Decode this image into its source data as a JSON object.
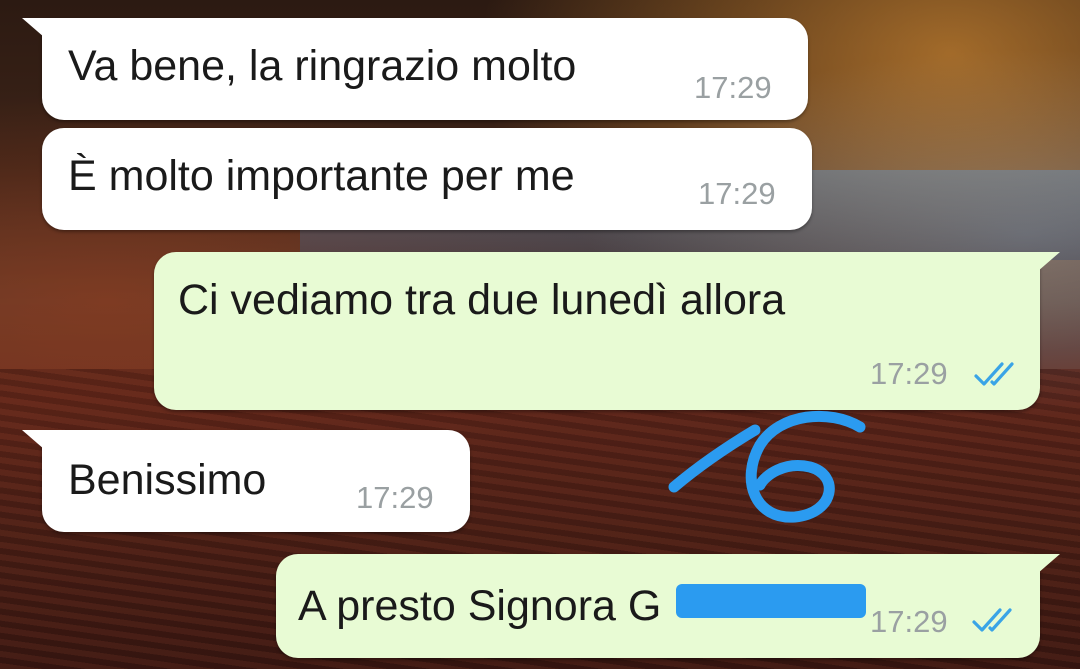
{
  "messages": [
    {
      "direction": "incoming",
      "text": "Va bene, la ringrazio molto",
      "time": "17:29"
    },
    {
      "direction": "incoming",
      "text": "È molto importante per me",
      "time": "17:29"
    },
    {
      "direction": "outgoing",
      "text": "Ci vediamo tra due lunedì allora",
      "time": "17:29",
      "status": "read"
    },
    {
      "direction": "incoming",
      "text": "Benissimo",
      "time": "17:29"
    },
    {
      "direction": "outgoing",
      "text": "A presto Signora G",
      "time": "17:29",
      "status": "read"
    }
  ],
  "annotation": {
    "text": "16",
    "color": "#2b9bf0"
  },
  "colors": {
    "incoming_bubble": "#ffffff",
    "outgoing_bubble": "#e8fbd4",
    "read_ticks": "#3aa4e6",
    "redaction": "#2b9bf0"
  },
  "icons": {
    "read_receipt": "double-check-icon"
  }
}
